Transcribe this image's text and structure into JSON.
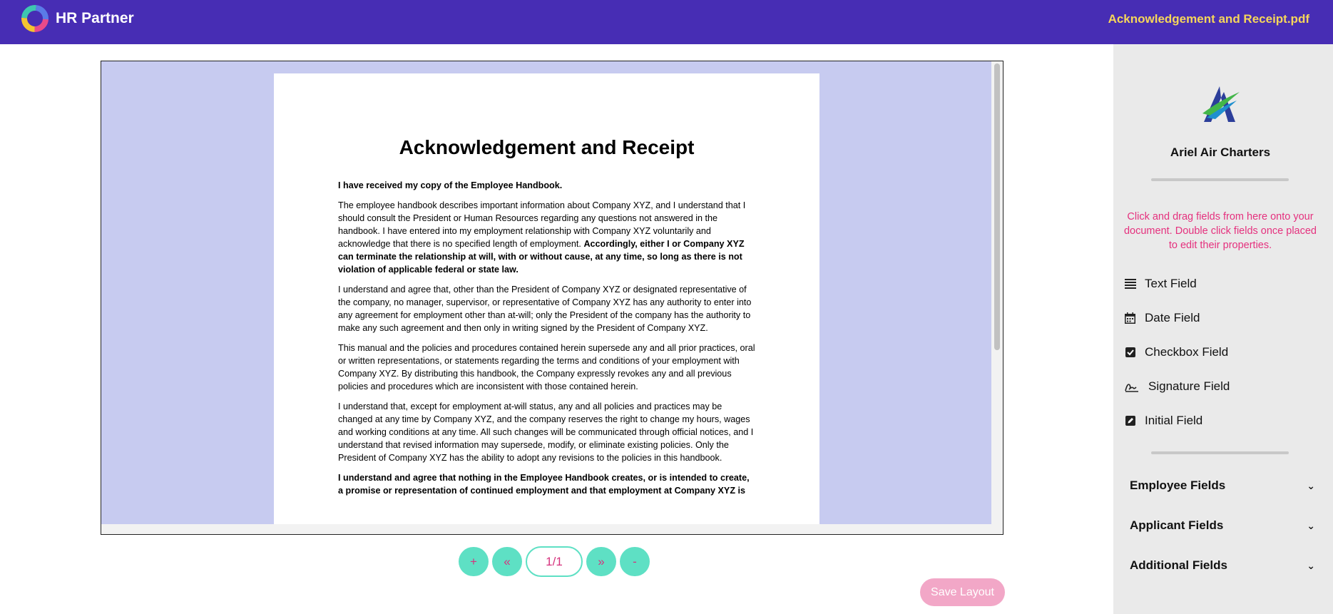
{
  "header": {
    "app_name": "HR Partner",
    "file_name": "Acknowledgement and Receipt.pdf"
  },
  "document": {
    "title": "Acknowledgement and Receipt",
    "p1": "I have received my copy of the Employee Handbook.",
    "p2_text": "The employee handbook describes important information about Company XYZ, and I understand that I should consult the President or Human Resources regarding any questions not answered in the handbook. I have entered into my employment relationship with Company XYZ voluntarily and acknowledge that there is no specified length of employment. ",
    "p2_bold": "Accordingly, either I or Company XYZ can terminate the relationship at will, with or without cause, at any time, so long as there is not violation of applicable federal or state law.",
    "p3": "I understand and agree that, other than the President of Company XYZ or designated representative of the company, no manager, supervisor, or representative of Company XYZ has any authority to enter into any agreement for employment other than at-will; only the President of the company has the authority to make any such agreement and then only in writing signed by the President of Company XYZ.",
    "p4": "This manual and the policies and procedures contained herein supersede any and all prior practices, oral or written representations, or statements regarding the terms and conditions of your employment with Company XYZ. By distributing this handbook, the Company expressly revokes any and all previous policies and procedures which are inconsistent with those contained herein.",
    "p5": "I understand that, except for employment at-will status, any and all policies and practices may be changed at any time by Company XYZ, and the company reserves the right to change my hours, wages and working conditions at any time. All such changes will be communicated through official notices, and I understand that revised information may supersede, modify, or eliminate existing policies. Only the President of Company XYZ has the ability to adopt any revisions to the policies in this handbook.",
    "p6": "I understand and agree that nothing in the Employee Handbook creates, or is intended to create, a promise or representation of continued employment and that employment at Company XYZ is"
  },
  "pager": {
    "zoom_in": "+",
    "prev": "«",
    "page_count": "1/1",
    "next": "»",
    "zoom_out": "-"
  },
  "save_label": "Save Layout",
  "sidebar": {
    "company_name": "Ariel Air Charters",
    "hint": "Click and drag fields from here onto your document. Double click fields once placed to edit their properties.",
    "fields": [
      {
        "label": "Text Field",
        "icon": "text-lines-icon"
      },
      {
        "label": "Date Field",
        "icon": "calendar-icon"
      },
      {
        "label": "Checkbox Field",
        "icon": "checkbox-icon"
      },
      {
        "label": "Signature Field",
        "icon": "signature-icon"
      },
      {
        "label": "Initial Field",
        "icon": "pen-square-icon"
      }
    ],
    "sections": [
      {
        "label": "Employee Fields"
      },
      {
        "label": "Applicant Fields"
      },
      {
        "label": "Additional Fields"
      }
    ]
  },
  "colors": {
    "header_bg": "#472db4",
    "file_name": "#f6d65a",
    "accent_teal": "#5ee0c4",
    "accent_pink": "#e5317e",
    "viewer_bg": "#c7cbf0"
  }
}
